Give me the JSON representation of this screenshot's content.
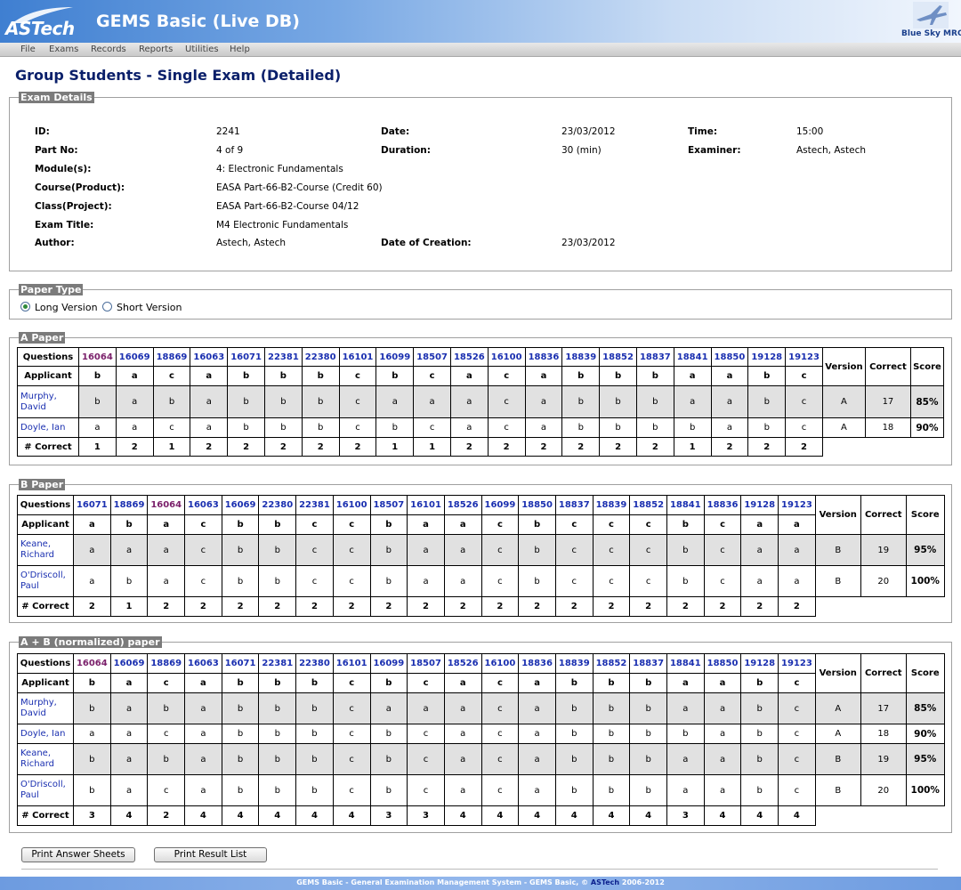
{
  "app": {
    "logo_text": "ASTech",
    "title": "GEMS Basic (Live DB)",
    "partner": "Blue Sky MRO"
  },
  "menu": [
    "File",
    "Exams",
    "Records",
    "Reports",
    "Utilities",
    "Help"
  ],
  "page_title": "Group Students - Single Exam (Detailed)",
  "exam": {
    "legend": "Exam Details",
    "labels": {
      "id": "ID:",
      "date": "Date:",
      "time": "Time:",
      "part": "Part No:",
      "duration": "Duration:",
      "examiner": "Examiner:",
      "module": "Module(s):",
      "course": "Course(Product):",
      "class": "Class(Project):",
      "title": "Exam Title:",
      "author": "Author:",
      "creation": "Date of Creation:"
    },
    "values": {
      "id": "2241",
      "date": "23/03/2012",
      "time": "15:00",
      "part": "4 of 9",
      "duration": "30 (min)",
      "examiner": "Astech, Astech",
      "module": "4: Electronic Fundamentals",
      "course": "EASA Part-66-B2-Course (Credit 60)",
      "class": "EASA Part-66-B2-Course 04/12",
      "title": "M4 Electronic Fundamentals",
      "author": "Astech, Astech",
      "creation": "23/03/2012"
    }
  },
  "paper_type": {
    "legend": "Paper Type",
    "long": "Long Version",
    "short": "Short Version",
    "selected": "long"
  },
  "table_labels": {
    "questions": "Questions",
    "applicant": "Applicant",
    "version": "Version",
    "correct": "Correct",
    "score": "Score",
    "num_correct": "# Correct"
  },
  "papers": [
    {
      "legend": "A Paper",
      "questions": [
        "16064",
        "16069",
        "18869",
        "16063",
        "16071",
        "22381",
        "22380",
        "16101",
        "16099",
        "18507",
        "18526",
        "16100",
        "18836",
        "18839",
        "18852",
        "18837",
        "18841",
        "18850",
        "19128",
        "19123"
      ],
      "visited": [
        0
      ],
      "answers": [
        "b",
        "a",
        "c",
        "a",
        "b",
        "b",
        "b",
        "c",
        "b",
        "c",
        "a",
        "c",
        "a",
        "b",
        "b",
        "b",
        "a",
        "a",
        "b",
        "c"
      ],
      "students": [
        {
          "name": "Murphy, David",
          "answers": [
            "b",
            "a",
            "b",
            "a",
            "b",
            "b",
            "b",
            "c",
            "a",
            "a",
            "a",
            "c",
            "a",
            "b",
            "b",
            "b",
            "a",
            "a",
            "b",
            "c"
          ],
          "version": "A",
          "correct": "17",
          "score": "85%"
        },
        {
          "name": "Doyle, Ian",
          "answers": [
            "a",
            "a",
            "c",
            "a",
            "b",
            "b",
            "b",
            "c",
            "b",
            "c",
            "a",
            "c",
            "a",
            "b",
            "b",
            "b",
            "b",
            "a",
            "b",
            "c"
          ],
          "version": "A",
          "correct": "18",
          "score": "90%"
        }
      ],
      "correct_counts": [
        "1",
        "2",
        "1",
        "2",
        "2",
        "2",
        "2",
        "2",
        "1",
        "1",
        "2",
        "2",
        "2",
        "2",
        "2",
        "2",
        "1",
        "2",
        "2",
        "2"
      ]
    },
    {
      "legend": "B Paper",
      "questions": [
        "16071",
        "18869",
        "16064",
        "16063",
        "16069",
        "22380",
        "22381",
        "16100",
        "18507",
        "16101",
        "18526",
        "16099",
        "18850",
        "18837",
        "18839",
        "18852",
        "18841",
        "18836",
        "19128",
        "19123"
      ],
      "visited": [
        2
      ],
      "answers": [
        "a",
        "b",
        "a",
        "c",
        "b",
        "b",
        "c",
        "c",
        "b",
        "a",
        "a",
        "c",
        "b",
        "c",
        "c",
        "c",
        "b",
        "c",
        "a",
        "a"
      ],
      "students": [
        {
          "name": "Keane, Richard",
          "answers": [
            "a",
            "a",
            "a",
            "c",
            "b",
            "b",
            "c",
            "c",
            "b",
            "a",
            "a",
            "c",
            "b",
            "c",
            "c",
            "c",
            "b",
            "c",
            "a",
            "a"
          ],
          "version": "B",
          "correct": "19",
          "score": "95%"
        },
        {
          "name": "O'Driscoll, Paul",
          "answers": [
            "a",
            "b",
            "a",
            "c",
            "b",
            "b",
            "c",
            "c",
            "b",
            "a",
            "a",
            "c",
            "b",
            "c",
            "c",
            "c",
            "b",
            "c",
            "a",
            "a"
          ],
          "version": "B",
          "correct": "20",
          "score": "100%"
        }
      ],
      "correct_counts": [
        "2",
        "1",
        "2",
        "2",
        "2",
        "2",
        "2",
        "2",
        "2",
        "2",
        "2",
        "2",
        "2",
        "2",
        "2",
        "2",
        "2",
        "2",
        "2",
        "2"
      ]
    },
    {
      "legend": "A + B (normalized) paper",
      "questions": [
        "16064",
        "16069",
        "18869",
        "16063",
        "16071",
        "22381",
        "22380",
        "16101",
        "16099",
        "18507",
        "18526",
        "16100",
        "18836",
        "18839",
        "18852",
        "18837",
        "18841",
        "18850",
        "19128",
        "19123"
      ],
      "visited": [
        0
      ],
      "answers": [
        "b",
        "a",
        "c",
        "a",
        "b",
        "b",
        "b",
        "c",
        "b",
        "c",
        "a",
        "c",
        "a",
        "b",
        "b",
        "b",
        "a",
        "a",
        "b",
        "c"
      ],
      "students": [
        {
          "name": "Murphy, David",
          "answers": [
            "b",
            "a",
            "b",
            "a",
            "b",
            "b",
            "b",
            "c",
            "a",
            "a",
            "a",
            "c",
            "a",
            "b",
            "b",
            "b",
            "a",
            "a",
            "b",
            "c"
          ],
          "version": "A",
          "correct": "17",
          "score": "85%"
        },
        {
          "name": "Doyle, Ian",
          "answers": [
            "a",
            "a",
            "c",
            "a",
            "b",
            "b",
            "b",
            "c",
            "b",
            "c",
            "a",
            "c",
            "a",
            "b",
            "b",
            "b",
            "b",
            "a",
            "b",
            "c"
          ],
          "version": "A",
          "correct": "18",
          "score": "90%"
        },
        {
          "name": "Keane, Richard",
          "answers": [
            "b",
            "a",
            "b",
            "a",
            "b",
            "b",
            "b",
            "c",
            "b",
            "c",
            "a",
            "c",
            "a",
            "b",
            "b",
            "b",
            "a",
            "a",
            "b",
            "c"
          ],
          "version": "B",
          "correct": "19",
          "score": "95%"
        },
        {
          "name": "O'Driscoll, Paul",
          "answers": [
            "b",
            "a",
            "c",
            "a",
            "b",
            "b",
            "b",
            "c",
            "b",
            "c",
            "a",
            "c",
            "a",
            "b",
            "b",
            "b",
            "a",
            "a",
            "b",
            "c"
          ],
          "version": "B",
          "correct": "20",
          "score": "100%"
        }
      ],
      "correct_counts": [
        "3",
        "4",
        "2",
        "4",
        "4",
        "4",
        "4",
        "4",
        "3",
        "3",
        "4",
        "4",
        "4",
        "4",
        "4",
        "4",
        "3",
        "4",
        "4",
        "4"
      ]
    }
  ],
  "buttons": {
    "print_sheets": "Print Answer Sheets",
    "print_results": "Print Result List"
  },
  "footer": {
    "prefix": "GEMS Basic - General Examination Management System - GEMS Basic, ©",
    "brand": "ASTech",
    "suffix": "2006-2012"
  },
  "colors": {
    "link": "#1a2fb0",
    "visited": "#7a1f6a",
    "legend_bg": "#7b7b7b",
    "title": "#0a1f6a"
  }
}
